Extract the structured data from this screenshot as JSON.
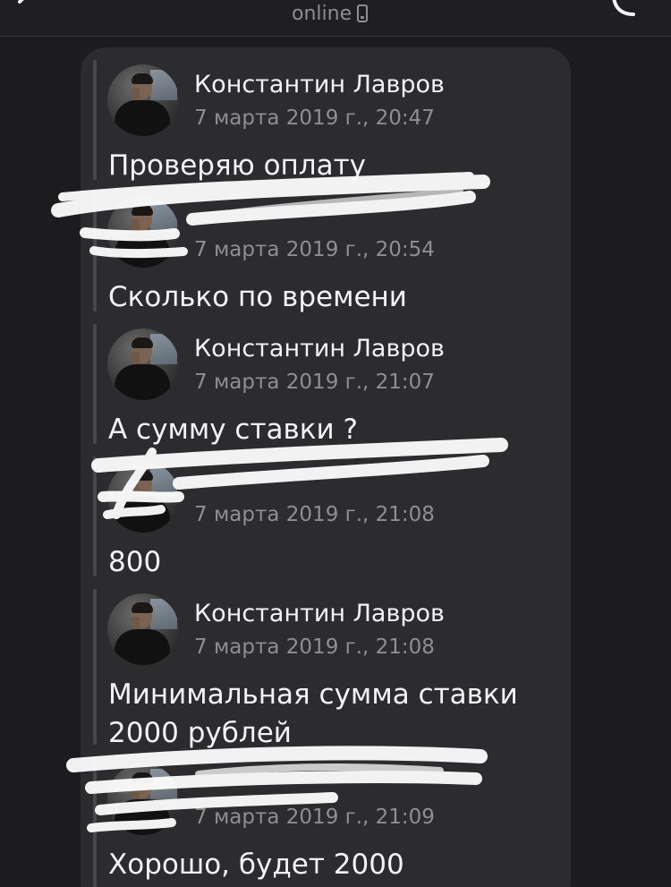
{
  "header": {
    "status": "online",
    "icons": [
      "chevron-left-icon",
      "phone-handset-icon",
      "call-icon"
    ]
  },
  "colors": {
    "background": "#1c1c1e",
    "bubble": "#2c2c2e",
    "quote_bar": "#48484a",
    "primary_text": "#f2f2f7",
    "secondary_text": "#8e8e93",
    "redaction": "#ffffff"
  },
  "messages": [
    {
      "sender": "Константин Лавров",
      "time": "7 марта 2019 г., 20:47",
      "text": "Проверяю оплату",
      "redacted": false
    },
    {
      "sender": "",
      "time": "7 марта 2019 г., 20:54",
      "text": "Сколько по времени",
      "redacted": true
    },
    {
      "sender": "Константин Лавров",
      "time": "7 марта 2019 г., 21:07",
      "text": "А сумму ставки ?",
      "redacted": false
    },
    {
      "sender": "",
      "time": "7 марта 2019 г., 21:08",
      "text": "800",
      "redacted": true
    },
    {
      "sender": "Константин Лавров",
      "time": "7 марта 2019 г., 21:08",
      "text": "Минимальная сумма ставки 2000 рублей",
      "redacted": false
    },
    {
      "sender": "",
      "time": "7 марта 2019 г., 21:09",
      "text": "Хорошо, будет 2000",
      "redacted": true
    }
  ]
}
